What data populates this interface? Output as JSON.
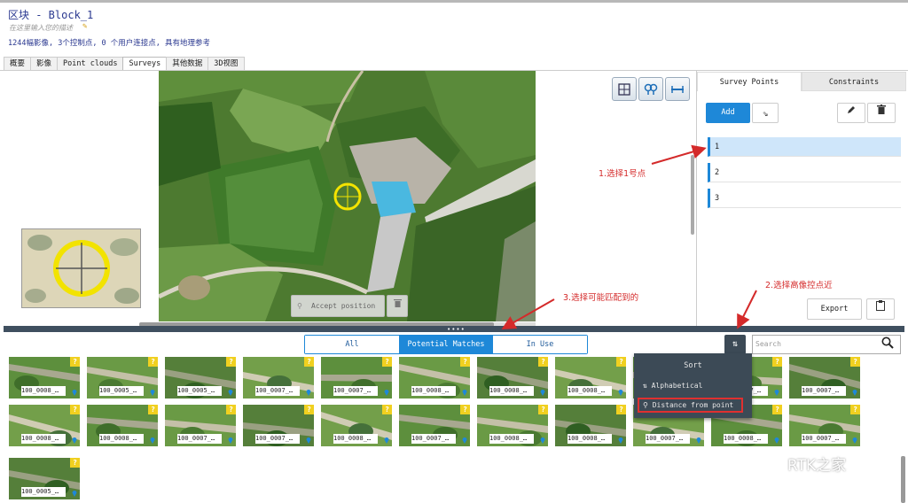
{
  "header": {
    "title": "区块 - Block_1",
    "subtitle": "在这里输入您的描述",
    "stats": "1244幅影像, 3个控制点, 0 个用户连接点, 具有地理参考"
  },
  "tabs": [
    "概要",
    "影像",
    "Point clouds",
    "Surveys",
    "其他数据",
    "3D视图"
  ],
  "active_tab": "Surveys",
  "map": {
    "accept_label": "Accept position",
    "tool_icons": [
      "grid-icon",
      "multi-pin-icon",
      "measure-icon"
    ]
  },
  "right_panel": {
    "tabs": [
      "Survey Points",
      "Constraints"
    ],
    "add_label": "Add",
    "points": [
      "1",
      "2",
      "3"
    ],
    "selected_point": "1",
    "export_label": "Export"
  },
  "filter": {
    "options": [
      "All",
      "Potential Matches",
      "In Use"
    ],
    "active": "Potential Matches"
  },
  "search": {
    "placeholder": "Search"
  },
  "sort_menu": {
    "title": "Sort",
    "options": [
      "Alphabetical",
      "Distance from point"
    ],
    "highlighted": "Distance from point"
  },
  "thumbnails": [
    "100_0008_…",
    "100_0005_…",
    "100_0005_…",
    "100_0007_…",
    "100_0007_…",
    "100_0008_…",
    "100_0008_…",
    "100_0008_…",
    "100_0008_…",
    "100_0007_…",
    "100_0007_…",
    "100_0008_…",
    "100_0008_…",
    "100_0007_…",
    "100_0007_…",
    "100_0008_…",
    "100_0007_…",
    "100_0008_…",
    "100_0008_…",
    "100_0007_…",
    "100_0008_…",
    "100_0007_…",
    "100_0005_…"
  ],
  "annotations": {
    "step1": "1.选择1号点",
    "step2": "2.选择高像控点近",
    "step3": "3.选择可能匹配到的"
  },
  "watermark": "RTK之家",
  "colors": {
    "accent": "#1e88d8",
    "annotation": "#d42a2a",
    "divider": "#3f4f5f",
    "menu": "#3c4a56"
  }
}
